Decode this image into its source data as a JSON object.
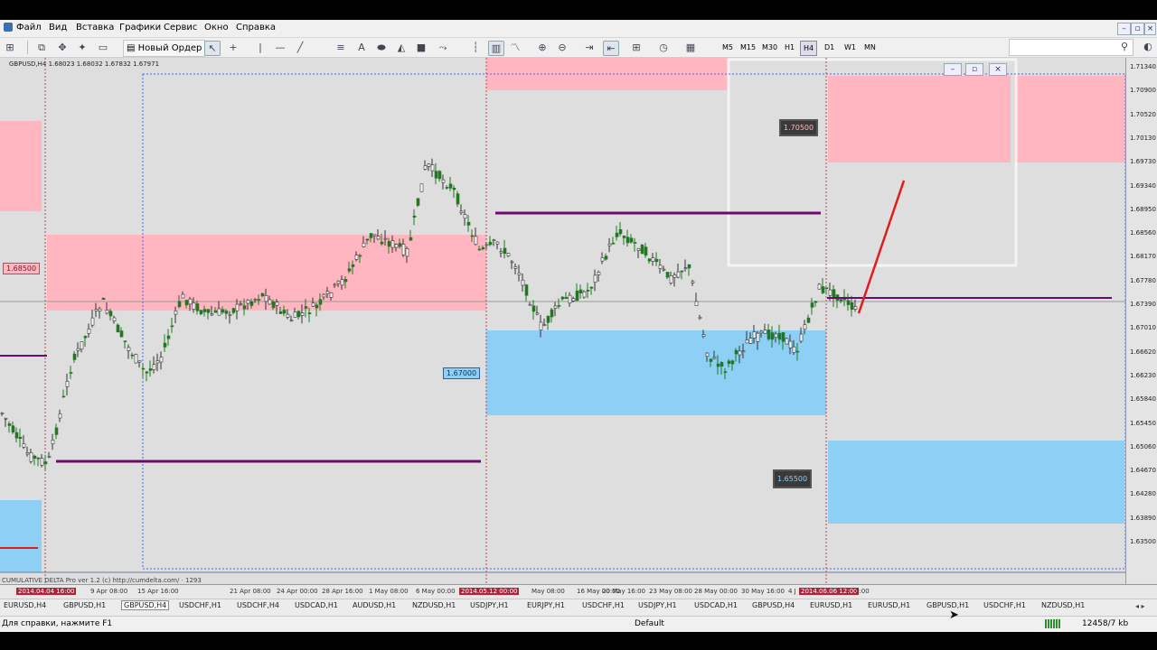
{
  "menu": [
    "Файл",
    "Вид",
    "Вставка",
    "Графики",
    "Сервис",
    "Окно",
    "Справка"
  ],
  "toolbar": {
    "new_order_label": "Новый Ордер",
    "timeframes": [
      "M5",
      "M15",
      "M30",
      "H1",
      "H4",
      "D1",
      "W1",
      "MN"
    ],
    "active_timeframe": "H4"
  },
  "chart": {
    "title": "GBPUSD,H4  1.68023 1.68032 1.67832 1.67971",
    "indicator_label": "CUMULATIVE DELTA Pro ver 1.2 (c) http://cumdelta.com/ · 1293",
    "price_labels": {
      "left_1": "1.68500",
      "mid_1": "1.67000",
      "top_right": "1.70500",
      "bottom_right": "1.65500"
    },
    "price_ticks": [
      "1.71340",
      "1.70900",
      "1.70520",
      "1.70130",
      "1.69730",
      "1.69340",
      "1.68950",
      "1.68560",
      "1.68170",
      "1.67780",
      "1.67390",
      "1.67010",
      "1.66620",
      "1.66230",
      "1.65840",
      "1.65450",
      "1.65060",
      "1.64670",
      "1.64280",
      "1.63890",
      "1.63500"
    ],
    "time_ticks": [
      "2014.04.04 16:00",
      "9 Apr 08:00",
      "15 Apr 16:00",
      "21 Apr 08:00",
      "24 Apr 00:00",
      "28 Apr 16:00",
      "1 May 08:00",
      "6 May 00:00",
      "2014.05.12 00:00",
      "May 08:00",
      "16 May 00:00",
      "20 May 16:00",
      "23 May 08:00",
      "28 May 00:00",
      "30 May 16:00",
      "4 J",
      "2014.06.06 12:00",
      "0:00"
    ],
    "highlighted_time_ticks": [
      0,
      8,
      16
    ]
  },
  "tabs": [
    "EURUSD,H4",
    "GBPUSD,H1",
    "GBPUSD,H4",
    "USDCHF,H1",
    "USDCHF,H4",
    "USDCAD,H1",
    "AUDUSD,H1",
    "NZDUSD,H1",
    "USDJPY,H1",
    "EURJPY,H1",
    "USDCHF,H1",
    "USDJPY,H1",
    "USDCAD,H1",
    "GBPUSD,H4",
    "EURUSD,H1",
    "EURUSD,H1",
    "GBPUSD,H1",
    "USDCHF,H1",
    "NZDUSD,H1"
  ],
  "active_tab": 2,
  "status": {
    "help": "Для справки, нажмите F1",
    "profile": "Default",
    "traffic": "12458/7 kb"
  },
  "window_controls": {
    "minimize": "–",
    "restore": "▫",
    "close": "×"
  },
  "colors": {
    "supply_zone": "#ffb6c1",
    "demand_zone": "#8ecff5",
    "level_line": "#6a0a6a",
    "trend_line": "#e21b1b",
    "bull_candle": "#1f7a1f",
    "bear_candle": "#333333"
  }
}
